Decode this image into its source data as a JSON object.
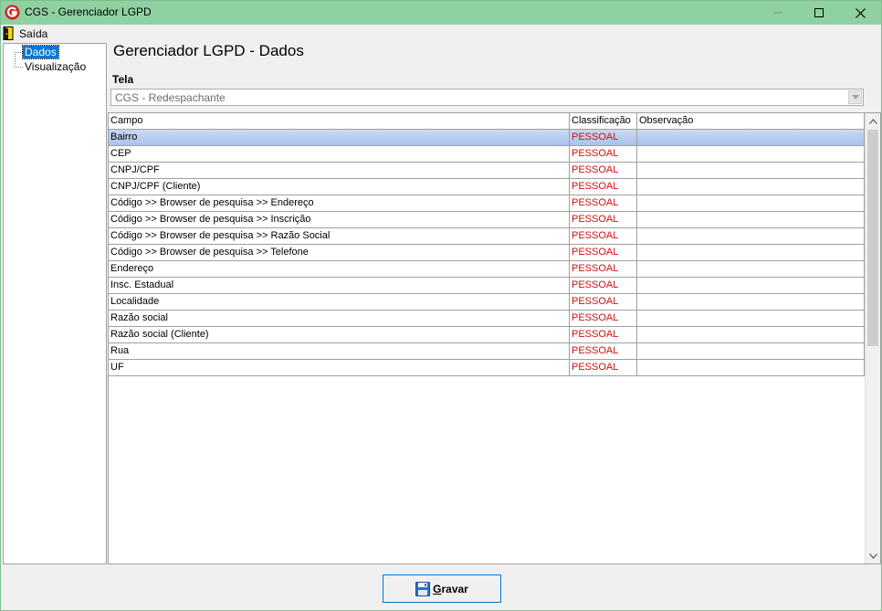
{
  "window": {
    "title": "CGS - Gerenciador LGPD",
    "icon": "cgs-logo-icon"
  },
  "menu": {
    "saida_label": "Saída",
    "saida_icon": "exit-door-icon"
  },
  "tree": {
    "items": [
      {
        "label": "Dados",
        "selected": true
      },
      {
        "label": "Visualização",
        "selected": false
      }
    ]
  },
  "main": {
    "title": "Gerenciador LGPD - Dados",
    "tela_label": "Tela",
    "tela_value": "CGS - Redespachante"
  },
  "grid": {
    "columns": [
      "Campo",
      "Classificação",
      "Observação"
    ],
    "rows": [
      {
        "campo": "Bairro",
        "classificacao": "PESSOAL",
        "observacao": ""
      },
      {
        "campo": "CEP",
        "classificacao": "PESSOAL",
        "observacao": ""
      },
      {
        "campo": "CNPJ/CPF",
        "classificacao": "PESSOAL",
        "observacao": ""
      },
      {
        "campo": "CNPJ/CPF (Cliente)",
        "classificacao": "PESSOAL",
        "observacao": ""
      },
      {
        "campo": "Código >> Browser de pesquisa >> Endereço",
        "classificacao": "PESSOAL",
        "observacao": ""
      },
      {
        "campo": "Código >> Browser de pesquisa >> Inscrição",
        "classificacao": "PESSOAL",
        "observacao": ""
      },
      {
        "campo": "Código >> Browser de pesquisa >> Razão Social",
        "classificacao": "PESSOAL",
        "observacao": ""
      },
      {
        "campo": "Código >> Browser de pesquisa >> Telefone",
        "classificacao": "PESSOAL",
        "observacao": ""
      },
      {
        "campo": "Endereço",
        "classificacao": "PESSOAL",
        "observacao": ""
      },
      {
        "campo": "Insc. Estadual",
        "classificacao": "PESSOAL",
        "observacao": ""
      },
      {
        "campo": "Localidade",
        "classificacao": "PESSOAL",
        "observacao": ""
      },
      {
        "campo": "Razão social",
        "classificacao": "PESSOAL",
        "observacao": ""
      },
      {
        "campo": "Razão social (Cliente)",
        "classificacao": "PESSOAL",
        "observacao": ""
      },
      {
        "campo": "Rua",
        "classificacao": "PESSOAL",
        "observacao": ""
      },
      {
        "campo": "UF",
        "classificacao": "PESSOAL",
        "observacao": ""
      }
    ]
  },
  "buttons": {
    "gravar_prefix": "G",
    "gravar_rest": "ravar",
    "gravar_icon": "floppy-disk-icon"
  },
  "colors": {
    "titlebar": "#8fd1a0",
    "classification_text": "#d01010",
    "selection": "#0078d7"
  }
}
